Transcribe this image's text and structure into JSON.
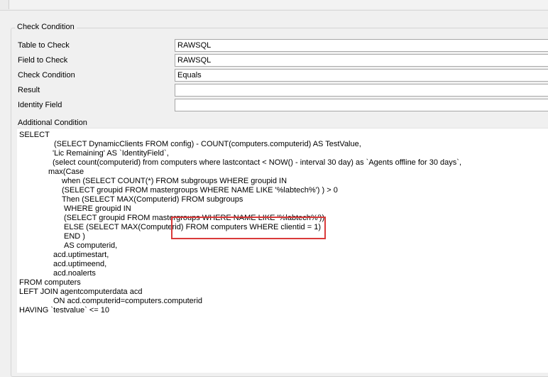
{
  "form": {
    "group_title": "Check Condition",
    "fields": [
      {
        "label": "Table to Check",
        "value": "RAWSQL"
      },
      {
        "label": "Field to Check",
        "value": "RAWSQL"
      },
      {
        "label": "Check Condition",
        "value": "Equals"
      },
      {
        "label": "Result",
        "value": ""
      },
      {
        "label": "Identity Field",
        "value": ""
      }
    ],
    "additional_label": "Additional Condition"
  },
  "sql": {
    "lines": [
      "SELECT",
      "(SELECT DynamicClients FROM config) - COUNT(computers.computerid) AS TestValue,",
      "'Lic Remaining' AS `IdentityField`,",
      "(select count(computerid) from computers where lastcontact < NOW() - interval 30 day) as `Agents offline for 30 days`,",
      "max(Case",
      "when (SELECT COUNT(*) FROM subgroups WHERE groupid IN",
      "(SELECT groupid FROM mastergroups WHERE NAME LIKE '%labtech%') ) > 0",
      "Then (SELECT MAX(Computerid) FROM subgroups",
      "WHERE groupid IN",
      "(SELECT groupid FROM mastergroups WHERE NAME LIKE '%labtech%'))",
      "ELSE (SELECT MAX(Computerid) FROM computers WHERE clientid = 1)",
      "END )",
      "AS computerid,",
      "acd.uptimestart,",
      "acd.uptimeend,",
      "acd.noalerts",
      "FROM computers",
      "LEFT JOIN agentcomputerdata acd",
      "ON acd.computerid=computers.computerid",
      "HAVING `testvalue` <= 10"
    ]
  }
}
